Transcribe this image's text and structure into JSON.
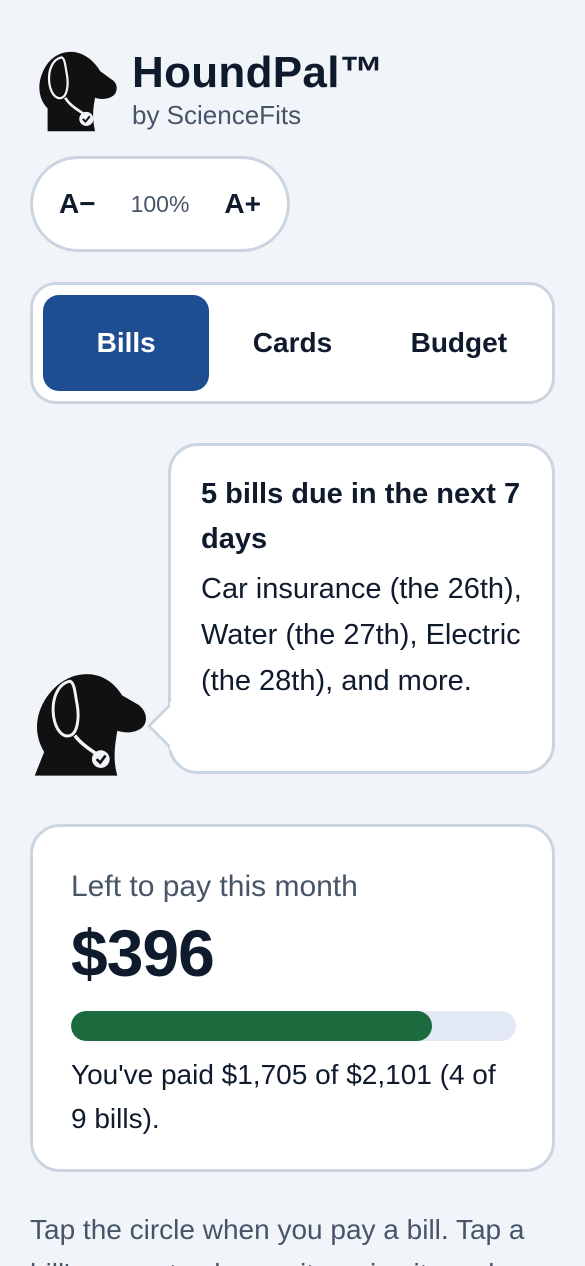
{
  "app": {
    "title": "HoundPal™",
    "subtitle": "by ScienceFits"
  },
  "zoom": {
    "decrease_label": "A−",
    "value": "100%",
    "increase_label": "A+"
  },
  "tabs": [
    {
      "label": "Bills",
      "active": true
    },
    {
      "label": "Cards",
      "active": false
    },
    {
      "label": "Budget",
      "active": false
    }
  ],
  "message": {
    "title": "5 bills due in the next 7 days",
    "body": "Car insurance (the 26th), Water (the 27th), Electric (the 28th), and more."
  },
  "summary": {
    "label": "Left to pay this month",
    "amount": "$396",
    "progress_fraction": 0.8115,
    "description": "You've paid $1,705 of $2,101 (4 of 9 bills)."
  },
  "hint": "Tap the circle when you pay a bill. Tap a bill's name to change it or give it a color.",
  "icons": {
    "logo": "dog-head-icon",
    "mascot": "dog-head-icon"
  },
  "colors": {
    "accent": "#1e4e91",
    "progress": "#1b6b3f",
    "track": "#e2e8f4",
    "border": "#cbd5e1",
    "background": "#f1f5f9"
  }
}
